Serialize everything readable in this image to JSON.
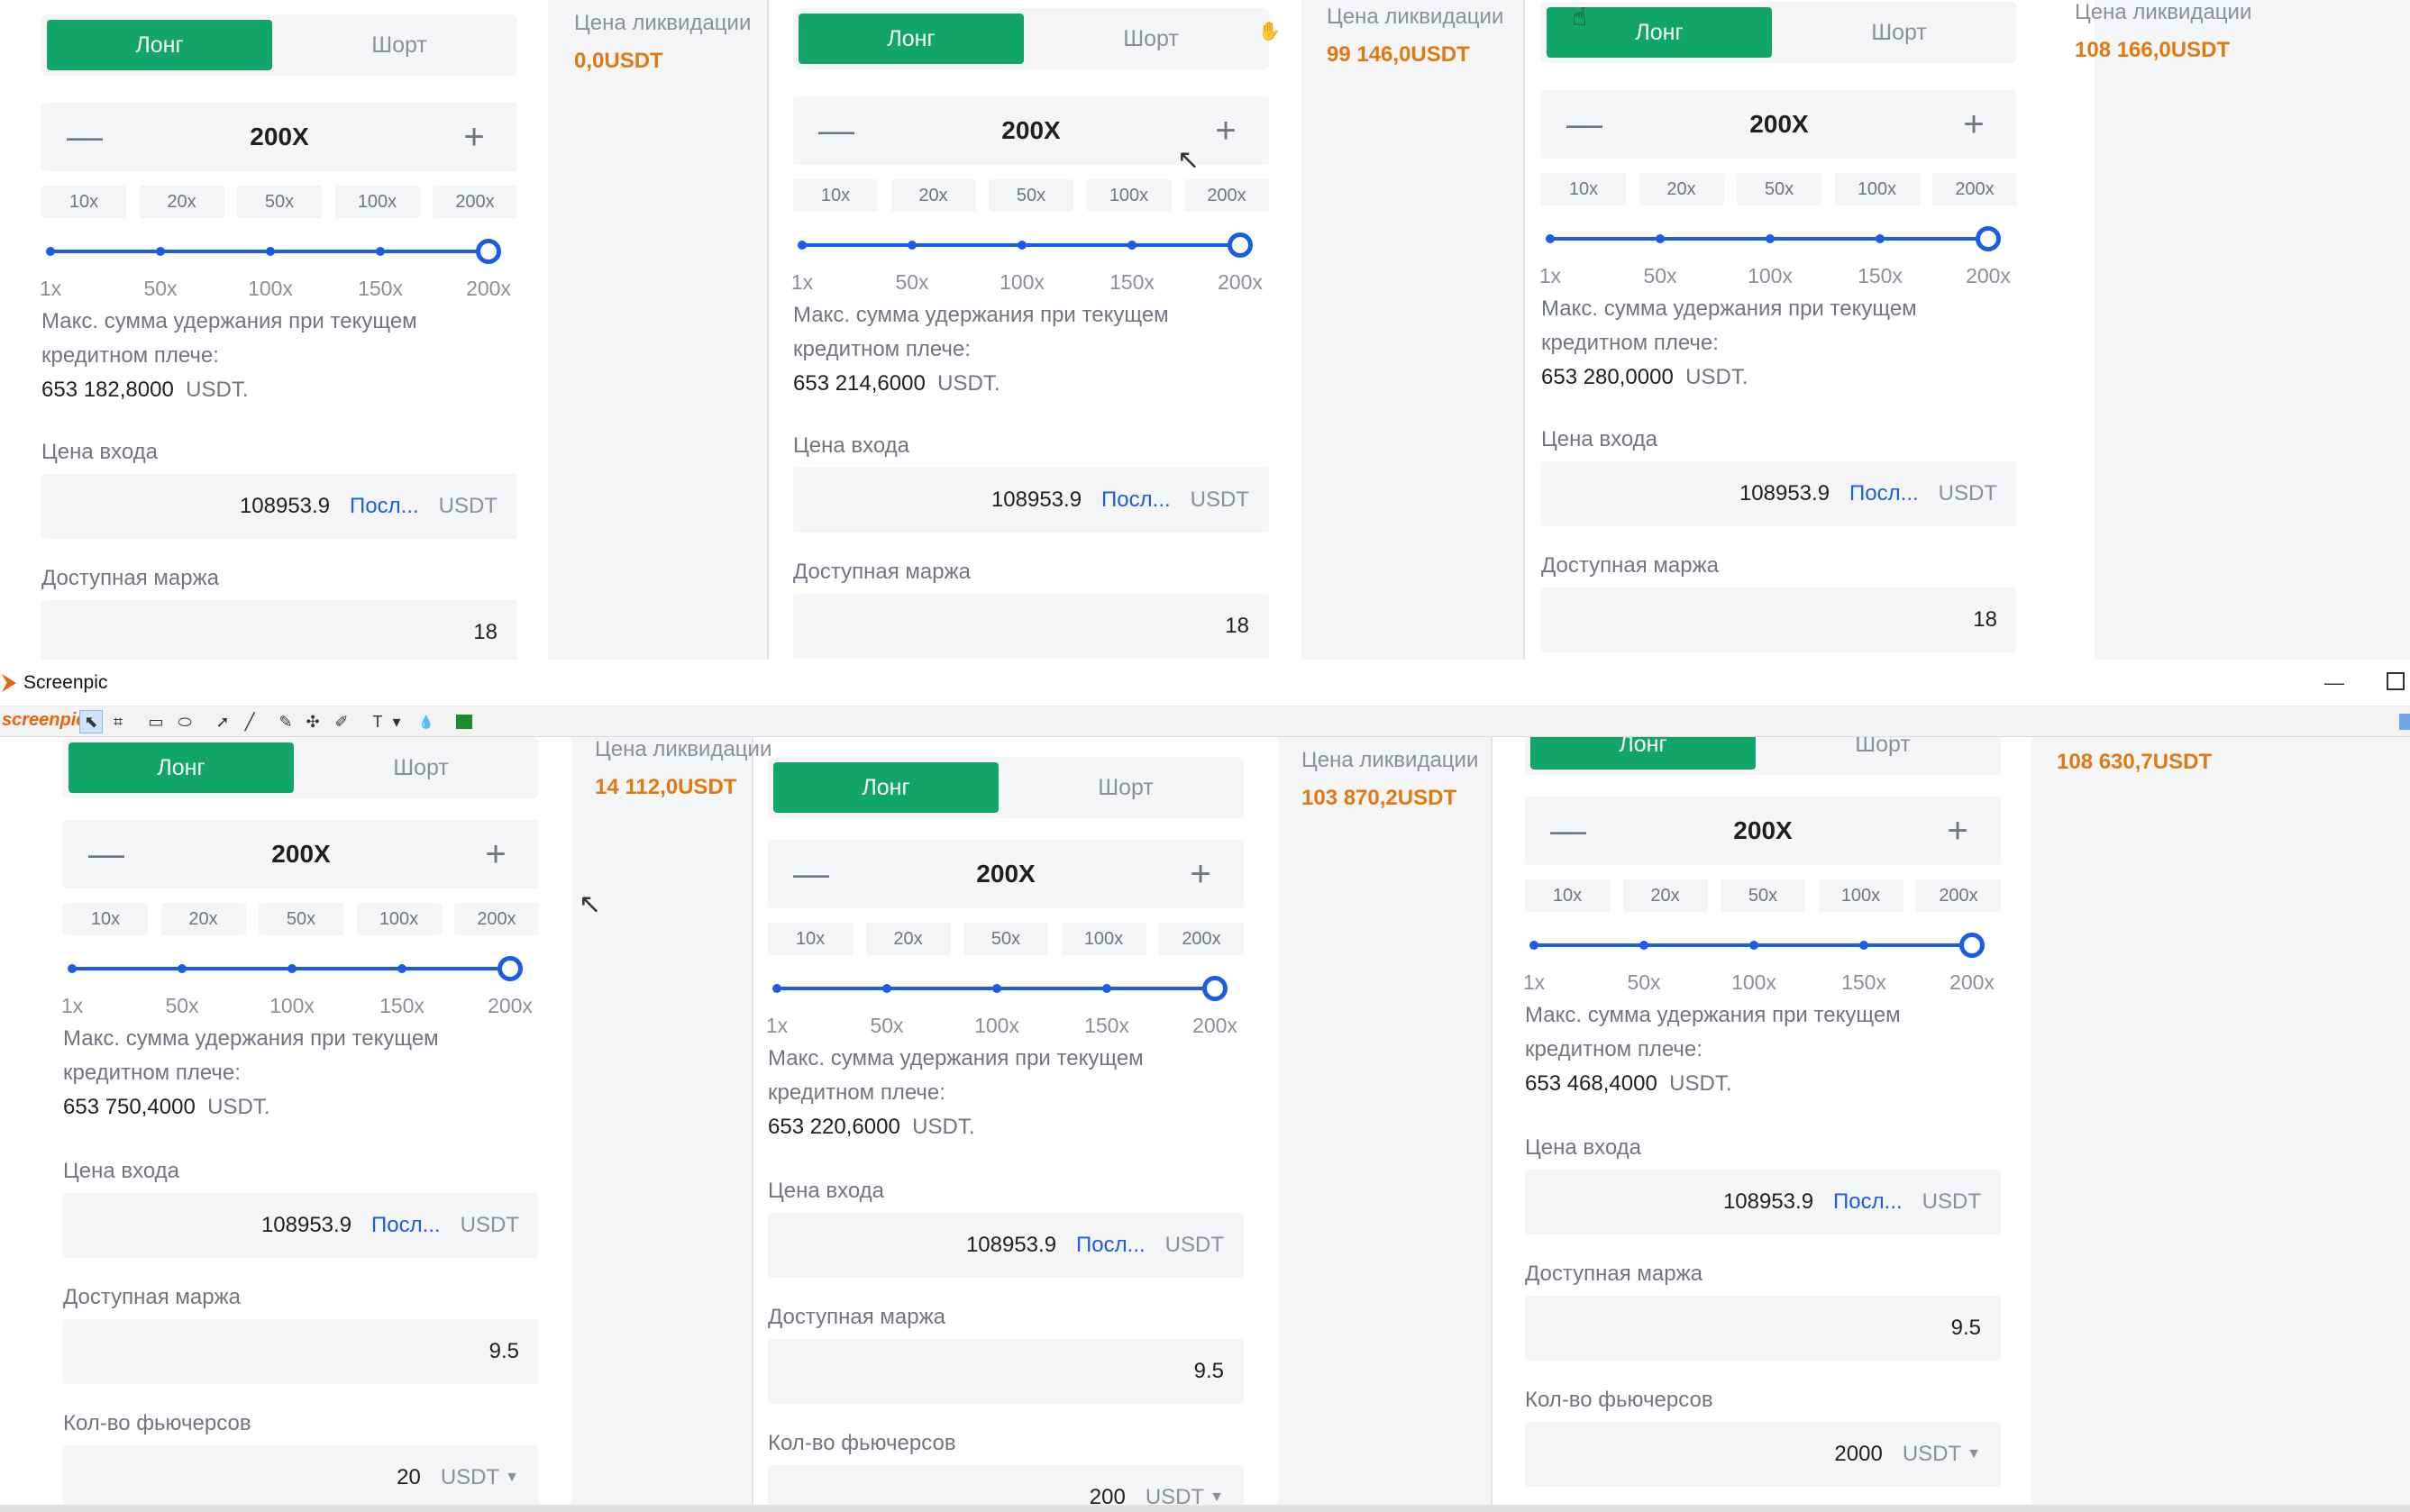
{
  "window": {
    "title": "Screenpic",
    "minimize": "—"
  },
  "toolbar": {
    "brand": "screenpic",
    "tools": [
      {
        "name": "select-tool-icon",
        "glyph": "⬉"
      },
      {
        "name": "crop-tool-icon",
        "glyph": "⌗"
      },
      {
        "name": "rectangle-tool-icon",
        "glyph": "▭"
      },
      {
        "name": "ellipse-tool-icon",
        "glyph": "⬭"
      },
      {
        "name": "arrow-tool-icon",
        "glyph": "➚"
      },
      {
        "name": "line-tool-icon",
        "glyph": "╱"
      },
      {
        "name": "pencil-tool-icon",
        "glyph": "✎"
      },
      {
        "name": "numbering-tool-icon",
        "glyph": "✣"
      },
      {
        "name": "marker-tool-icon",
        "glyph": "✐"
      },
      {
        "name": "text-tool-icon",
        "glyph": "T"
      },
      {
        "name": "text-dropdown-icon",
        "glyph": "▾"
      },
      {
        "name": "blur-tool-icon",
        "glyph": "💧"
      }
    ]
  },
  "common": {
    "long": "Лонг",
    "short": "Шорт",
    "minus": "—",
    "plus": "+",
    "leverage": "200X",
    "chips": [
      "10x",
      "20x",
      "50x",
      "100x",
      "200x"
    ],
    "ticks": [
      "1x",
      "50x",
      "100x",
      "150x",
      "200x"
    ],
    "slider_value": 200,
    "maxsum_label": "Макс. сумма удержания при текущем кредитном плече:",
    "usdt_dot": "USDT.",
    "entry_label": "Цена входа",
    "entry_price": "108953.9",
    "last_link": "Посл...",
    "usdt": "USDT",
    "margin_label": "Доступная маржа",
    "qty_label": "Кол-во фьючерсов",
    "liq_label": "Цена ликвидации",
    "caret": "▼"
  },
  "panels": [
    {
      "maxsum": "653 182,8000",
      "margin": "18",
      "liq": "0,0USDT"
    },
    {
      "maxsum": "653 214,6000",
      "margin": "18",
      "liq": "99 146,0USDT"
    },
    {
      "maxsum": "653 280,0000",
      "margin": "18",
      "liq": "108 166,0USDT"
    },
    {
      "maxsum": "653 750,4000",
      "margin": "9.5",
      "qty": "20",
      "liq": "14 112,0USDT"
    },
    {
      "maxsum": "653 220,6000",
      "margin": "9.5",
      "qty": "200",
      "liq": "103 870,2USDT"
    },
    {
      "maxsum": "653 468,4000",
      "margin": "9.5",
      "qty": "2000",
      "liq": "108 630,7USDT"
    }
  ]
}
